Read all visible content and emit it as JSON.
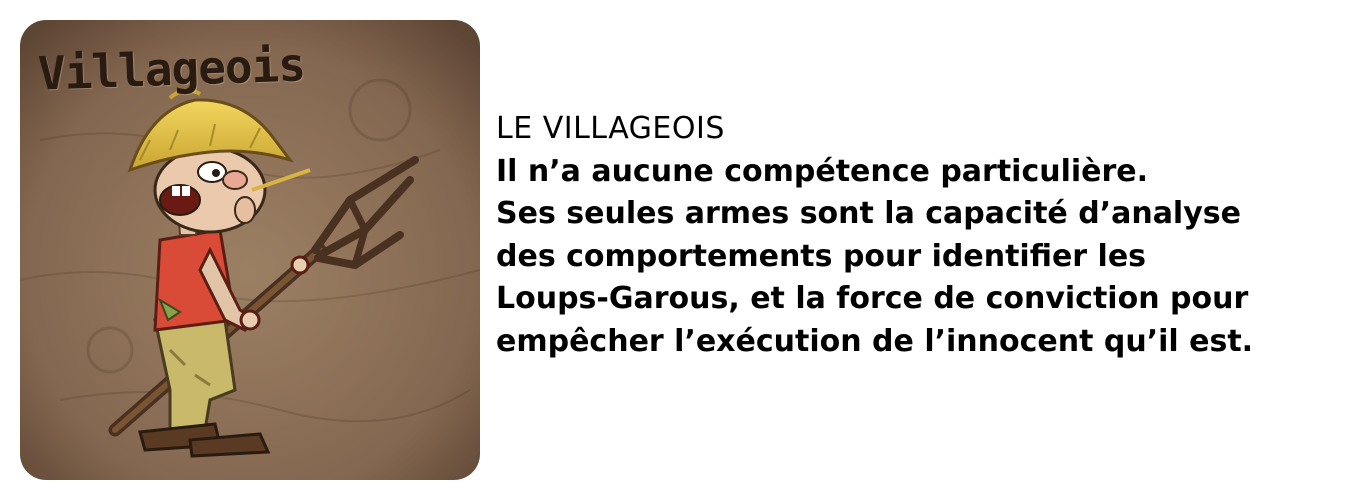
{
  "card": {
    "title": "Villageois",
    "illustration": "villager-with-pitchfork",
    "colors": {
      "background": "#8a6e55",
      "hat": "#e6c64a",
      "shirt": "#d94b36",
      "pants": "#c9b96a",
      "pitchfork": "#4a3020",
      "ink": "#2a1b10"
    }
  },
  "description": {
    "heading": "LE VILLAGEOIS",
    "lines": [
      "Il n’a aucune compétence particulière.",
      "Ses seules armes sont la capacité d’analyse",
      "des comportements pour identifier les",
      "Loups-Garous, et la force de conviction pour",
      "empêcher l’exécution de l’innocent qu’il est."
    ]
  }
}
